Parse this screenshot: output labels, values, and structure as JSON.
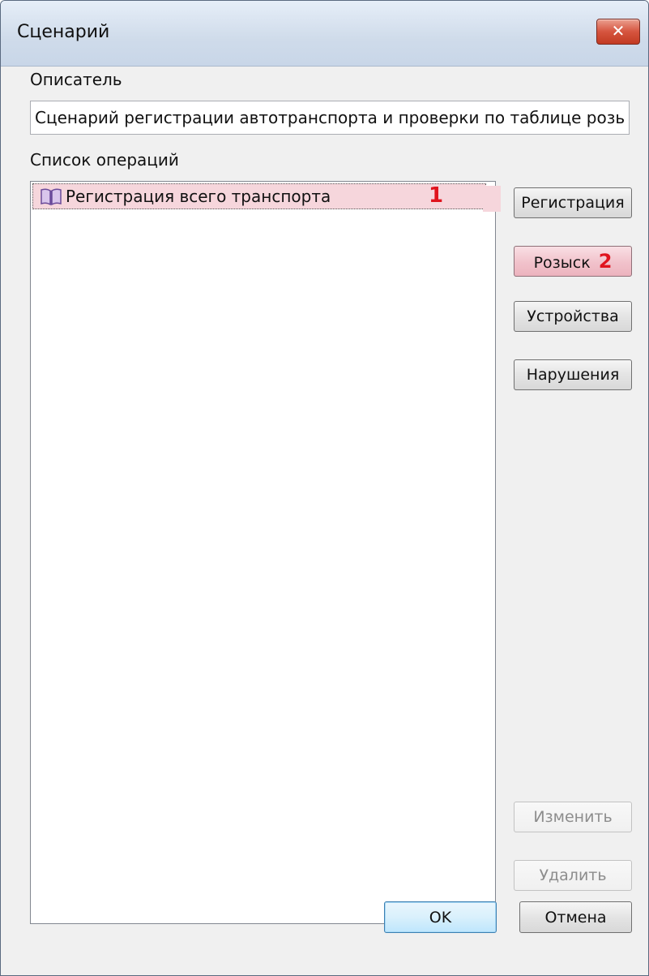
{
  "window": {
    "title": "Сценарий",
    "close_glyph": "✕"
  },
  "descriptor": {
    "label": "Описатель",
    "value": "Сценарий регистрации автотранспорта и проверки по таблице розыска"
  },
  "operations": {
    "label": "Список операций",
    "items": [
      {
        "label": "Регистрация всего транспорта",
        "icon": "book-icon",
        "marker": "1",
        "selected": true
      }
    ]
  },
  "side_buttons": {
    "registration": "Регистрация",
    "search": "Розыск",
    "search_marker": "2",
    "devices": "Устройства",
    "violations": "Нарушения",
    "edit": "Изменить",
    "delete": "Удалить"
  },
  "footer": {
    "ok": "OK",
    "cancel": "Отмена"
  },
  "colors": {
    "highlight": "#f6d6dc",
    "marker": "#e0141e",
    "close_button": "#c23a22"
  }
}
